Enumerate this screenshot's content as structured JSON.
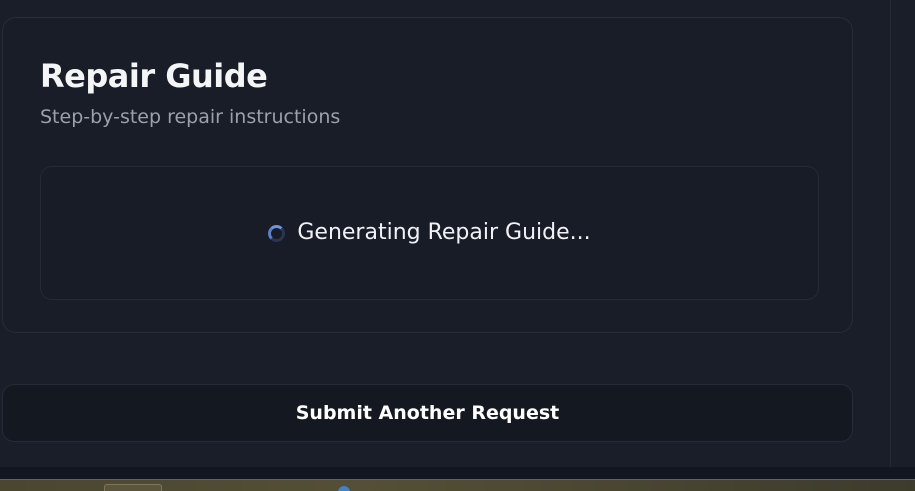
{
  "repair_guide": {
    "title": "Repair Guide",
    "subtitle": "Step-by-step repair instructions",
    "loading_text": "Generating Repair Guide..."
  },
  "actions": {
    "submit_another_label": "Submit Another Request"
  },
  "icons": {
    "loading": "spinner-icon"
  },
  "colors": {
    "background": "#1a1e29",
    "card_background": "#191d27",
    "spinner_accent": "#6f93de",
    "text_primary": "#f4f5f7",
    "text_secondary": "#9aa0ad"
  }
}
